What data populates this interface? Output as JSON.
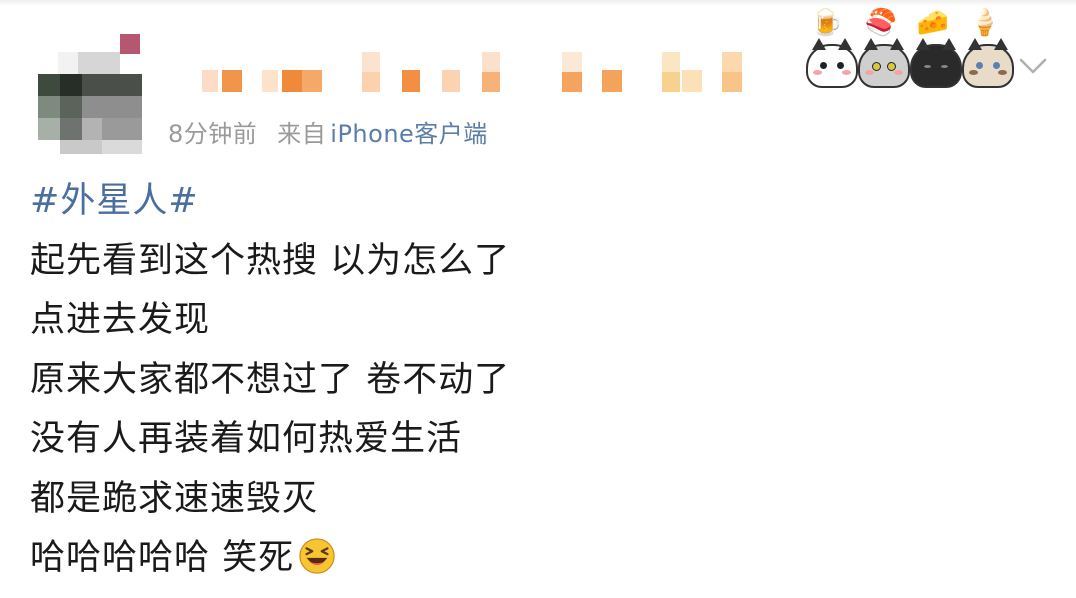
{
  "post": {
    "time_ago": "8分钟前",
    "source_prefix": "来自",
    "source_device": "iPhone客户端",
    "hashtag": "#外星人#",
    "lines": [
      "起先看到这个热搜 以为怎么了",
      "点进去发现",
      "原来大家都不想过了 卷不动了",
      "没有人再装着如何热爱生活",
      "都是跪求速速毁灭",
      "哈哈哈哈哈 笑死"
    ]
  },
  "icons": {
    "avatar": "pixelated-avatar",
    "username": "blurred-username",
    "stickers": [
      "beer-mug-icon",
      "sushi-icon",
      "cheese-icon",
      "ice-cream-icon"
    ],
    "cats": [
      "white-cat-sticker",
      "gray-tabby-cat-sticker",
      "black-cat-sticker",
      "siamese-cat-sticker"
    ],
    "menu": "chevron-down-icon",
    "emoji": "laughing-squint-emoji"
  },
  "colors": {
    "text": "#1a1a1a",
    "meta": "#9a9a9a",
    "link": "#4a6ea0",
    "emoji": "#f7c531"
  }
}
